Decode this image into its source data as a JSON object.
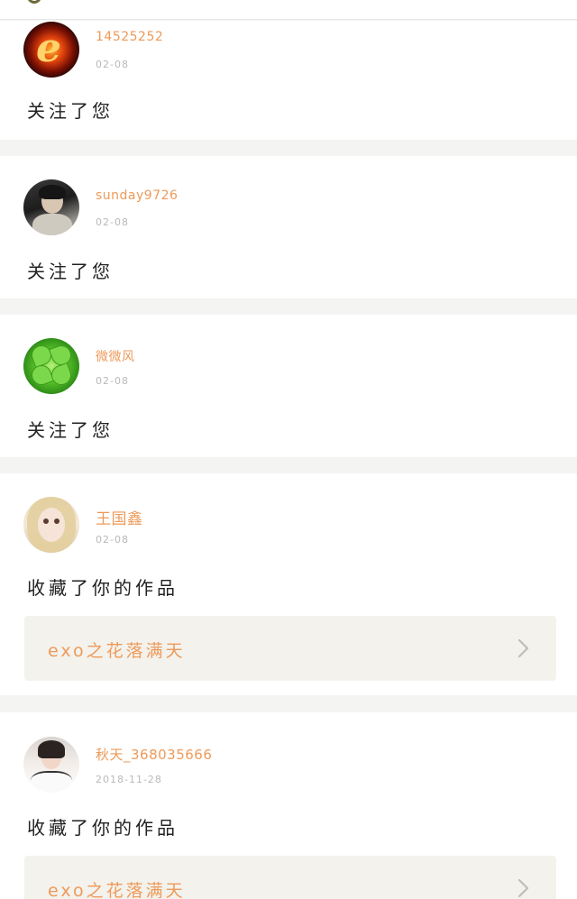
{
  "theme": {
    "accent": "#ee9a5a",
    "work_bg": "#f3f2ec",
    "chevron": "#bdbdbd"
  },
  "notifications": [
    {
      "user": "14525252",
      "date": "02-08",
      "action": "关注了您",
      "avatar_icon": "fire-e-avatar"
    },
    {
      "user": "sunday9726",
      "date": "02-08",
      "action": "关注了您",
      "avatar_icon": "portrait-avatar"
    },
    {
      "user": "微微风",
      "date": "02-08",
      "action": "关注了您",
      "avatar_icon": "clover-avatar"
    },
    {
      "user": "王国鑫",
      "date": "02-08",
      "action": "收藏了你的作品",
      "work_title": "exo之花落满天",
      "avatar_icon": "doll-avatar"
    },
    {
      "user": "秋天_368035666",
      "date": "2018-11-28",
      "action": "收藏了你的作品",
      "work_title": "exo之花落满天",
      "avatar_icon": "girl-avatar"
    }
  ]
}
